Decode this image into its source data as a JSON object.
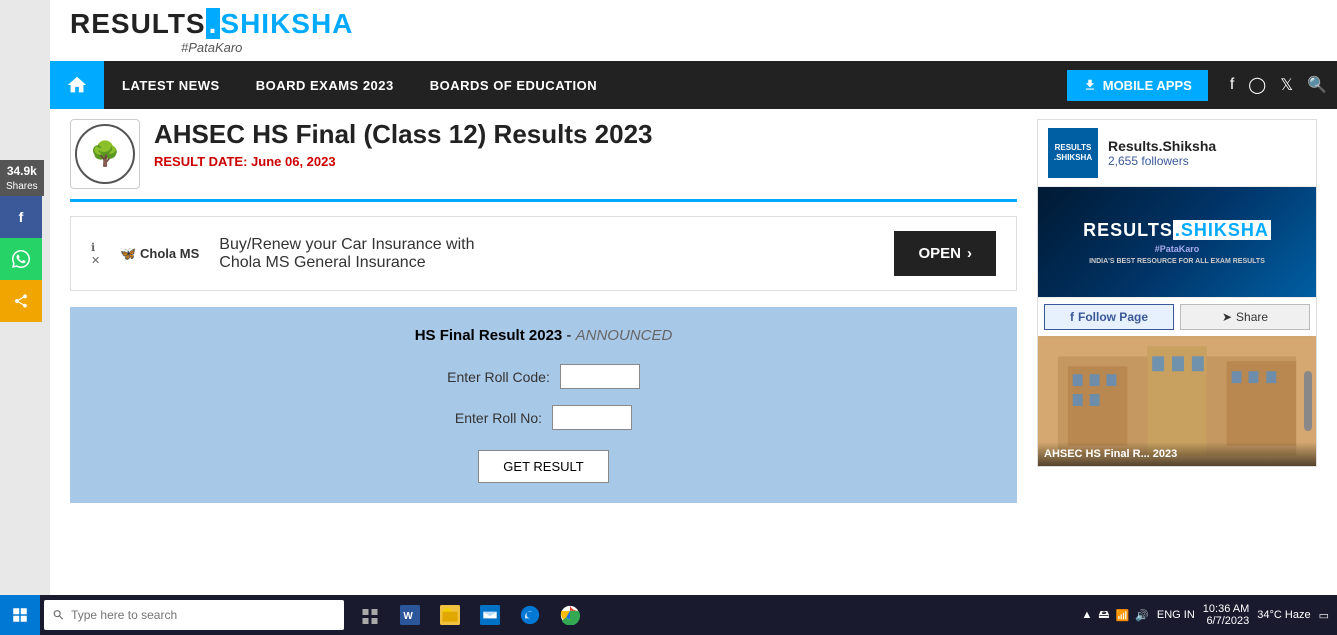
{
  "site": {
    "logo_results": "RESULTS",
    "logo_dot": ".",
    "logo_shiksha": "SHIKSHA",
    "logo_tagline": "#PataKaro"
  },
  "nav": {
    "home_label": "Home",
    "links": [
      "LATEST NEWS",
      "BOARD EXAMS 2023",
      "BOARDS OF EDUCATION"
    ],
    "mobile_btn": "MOBILE APPS",
    "search_icon": "search"
  },
  "share": {
    "count": "34.9k",
    "shares_label": "Shares",
    "facebook_icon": "f",
    "whatsapp_icon": "w",
    "share_icon": "share"
  },
  "article": {
    "title": "AHSEC HS Final (Class 12) Results 2023",
    "result_date_label": "RESULT DATE:",
    "result_date": "June 06, 2023"
  },
  "ad": {
    "company": "Chola MS",
    "text_line1": "Buy/Renew your Car Insurance with",
    "text_line2": "Chola MS General Insurance",
    "open_btn": "OPEN"
  },
  "form": {
    "title": "HS Final Result 2023",
    "status": "ANNOUNCED",
    "roll_code_label": "Enter Roll Code:",
    "roll_no_label": "Enter Roll No:",
    "submit_btn": "GET RESULT"
  },
  "sidebar": {
    "page_name": "Results.Shiksha",
    "followers": "2,655 followers",
    "fb_logo_line1": "RESULTS",
    "fb_logo_line2": ".SHIKSHA",
    "fb_logo_line3": "#PataKaro",
    "fb_tagline": "INDIA'S BEST RESOURCE FOR ALL EXAM RESULTS",
    "follow_btn": "Follow Page",
    "share_btn": "Share",
    "building_caption": "AHSEC HS Final R... 2023"
  },
  "taskbar": {
    "search_placeholder": "Type here to search",
    "time": "10:36 AM",
    "date": "6/7/2023",
    "weather": "34°C  Haze",
    "language": "ENG IN"
  }
}
